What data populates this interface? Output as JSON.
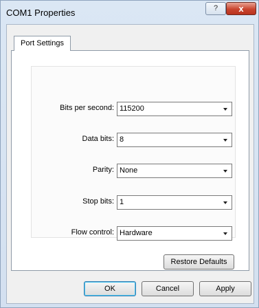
{
  "window": {
    "title": "COM1 Properties",
    "help_label": "?",
    "close_label": "x"
  },
  "tabs": [
    {
      "label": "Port Settings",
      "active": true
    }
  ],
  "settings": {
    "bits_per_second": {
      "label": "Bits per second:",
      "value": "115200"
    },
    "data_bits": {
      "label": "Data bits:",
      "value": "8"
    },
    "parity": {
      "label": "Parity:",
      "value": "None"
    },
    "stop_bits": {
      "label": "Stop bits:",
      "value": "1"
    },
    "flow_control": {
      "label": "Flow control:",
      "value": "Hardware"
    }
  },
  "buttons": {
    "restore_defaults": "Restore Defaults",
    "ok": "OK",
    "cancel": "Cancel",
    "apply": "Apply"
  }
}
